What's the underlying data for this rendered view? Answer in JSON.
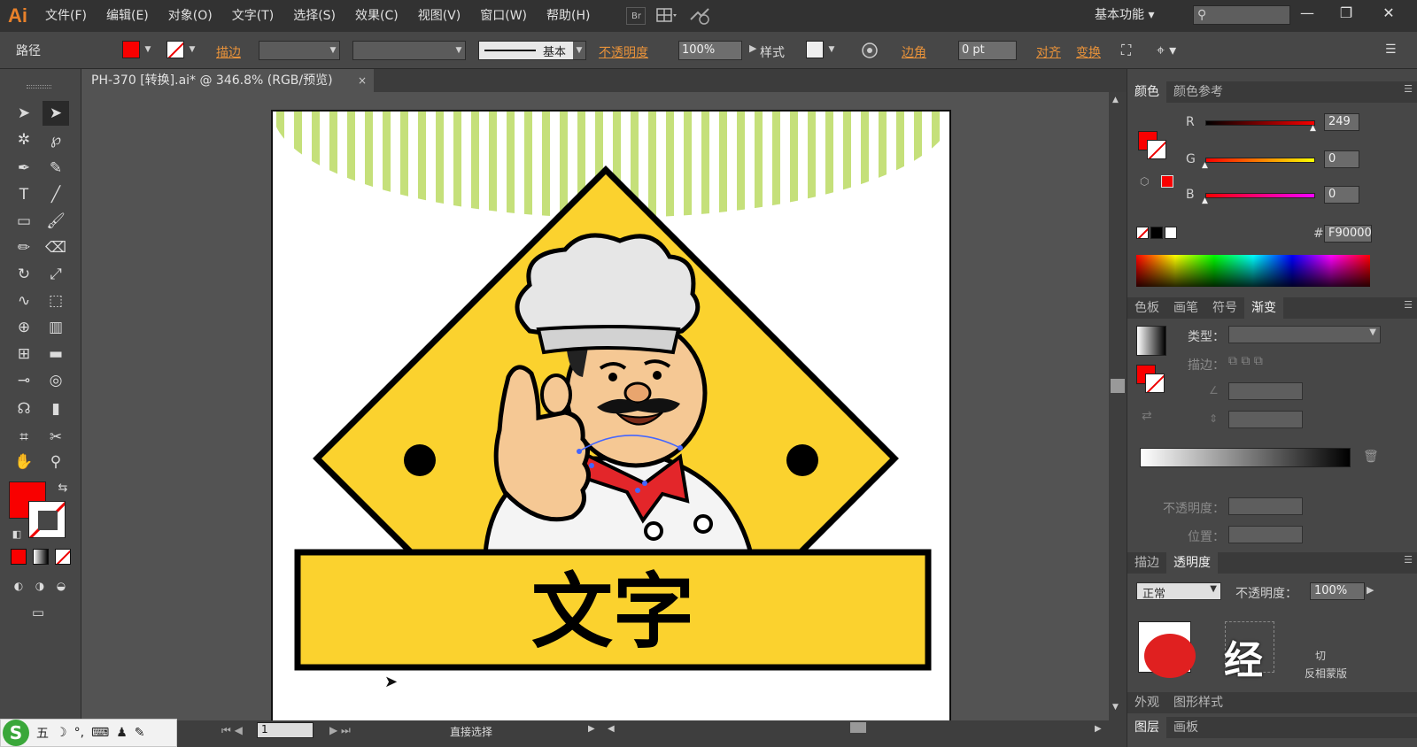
{
  "app": {
    "logo": "Ai",
    "menu": [
      "文件(F)",
      "编辑(E)",
      "对象(O)",
      "文字(T)",
      "选择(S)",
      "效果(C)",
      "视图(V)",
      "窗口(W)",
      "帮助(H)"
    ],
    "bridge_label": "Br",
    "workspace": "基本功能",
    "search_placeholder": "",
    "window_controls": [
      "—",
      "❐",
      "✕"
    ]
  },
  "control_bar": {
    "object_type": "路径",
    "fill_color": "#f90000",
    "stroke_label": "描边",
    "stroke_weight": "",
    "brush_label": "基本",
    "opacity_label": "不透明度",
    "opacity_value": "100%",
    "style_label": "样式",
    "corner_label": "边角",
    "corner_value": "0 pt",
    "align_label": "对齐",
    "transform_label": "变换"
  },
  "document_tab": {
    "title": "PH-370 [转换].ai* @ 346.8% (RGB/预览)",
    "close": "×"
  },
  "artwork": {
    "banner_text": "文字",
    "colors": {
      "yellow": "#fbd22e",
      "green_stripes": "#c5e07a",
      "scarf": "#e3262a",
      "hat": "#e6e6e6",
      "skin": "#f5c894"
    }
  },
  "status_bar": {
    "page_field": "1",
    "tool_name": "直接选择"
  },
  "color_panel": {
    "tabs": [
      "颜色",
      "颜色参考"
    ],
    "active_tab": "颜色",
    "r_label": "R",
    "g_label": "G",
    "b_label": "B",
    "r_value": "249",
    "g_value": "0",
    "b_value": "0",
    "hex_label": "#",
    "hex_value": "F90000",
    "r": 249,
    "g": 0,
    "b": 0
  },
  "gradient_panel": {
    "tabs": [
      "色板",
      "画笔",
      "符号",
      "渐变"
    ],
    "active_tab": "渐变",
    "type_label": "类型：",
    "stroke_label": "描边：",
    "opacity_label": "不透明度：",
    "position_label": "位置："
  },
  "transparency_panel": {
    "tabs": [
      "描边",
      "透明度"
    ],
    "active_tab": "透明度",
    "mode": "正常",
    "opacity_label": "不透明度：",
    "opacity_value": "100%",
    "partial_labels": [
      "切",
      "反相蒙版"
    ],
    "partial_bottom": [
      "外观",
      "图形样式"
    ]
  },
  "layers_panel": {
    "tabs": [
      "图层",
      "画板"
    ]
  },
  "watermark": "经",
  "ime": {
    "logo": "S",
    "items": [
      "五",
      "☽",
      "°,",
      "⌨",
      "♟",
      "✎"
    ]
  }
}
